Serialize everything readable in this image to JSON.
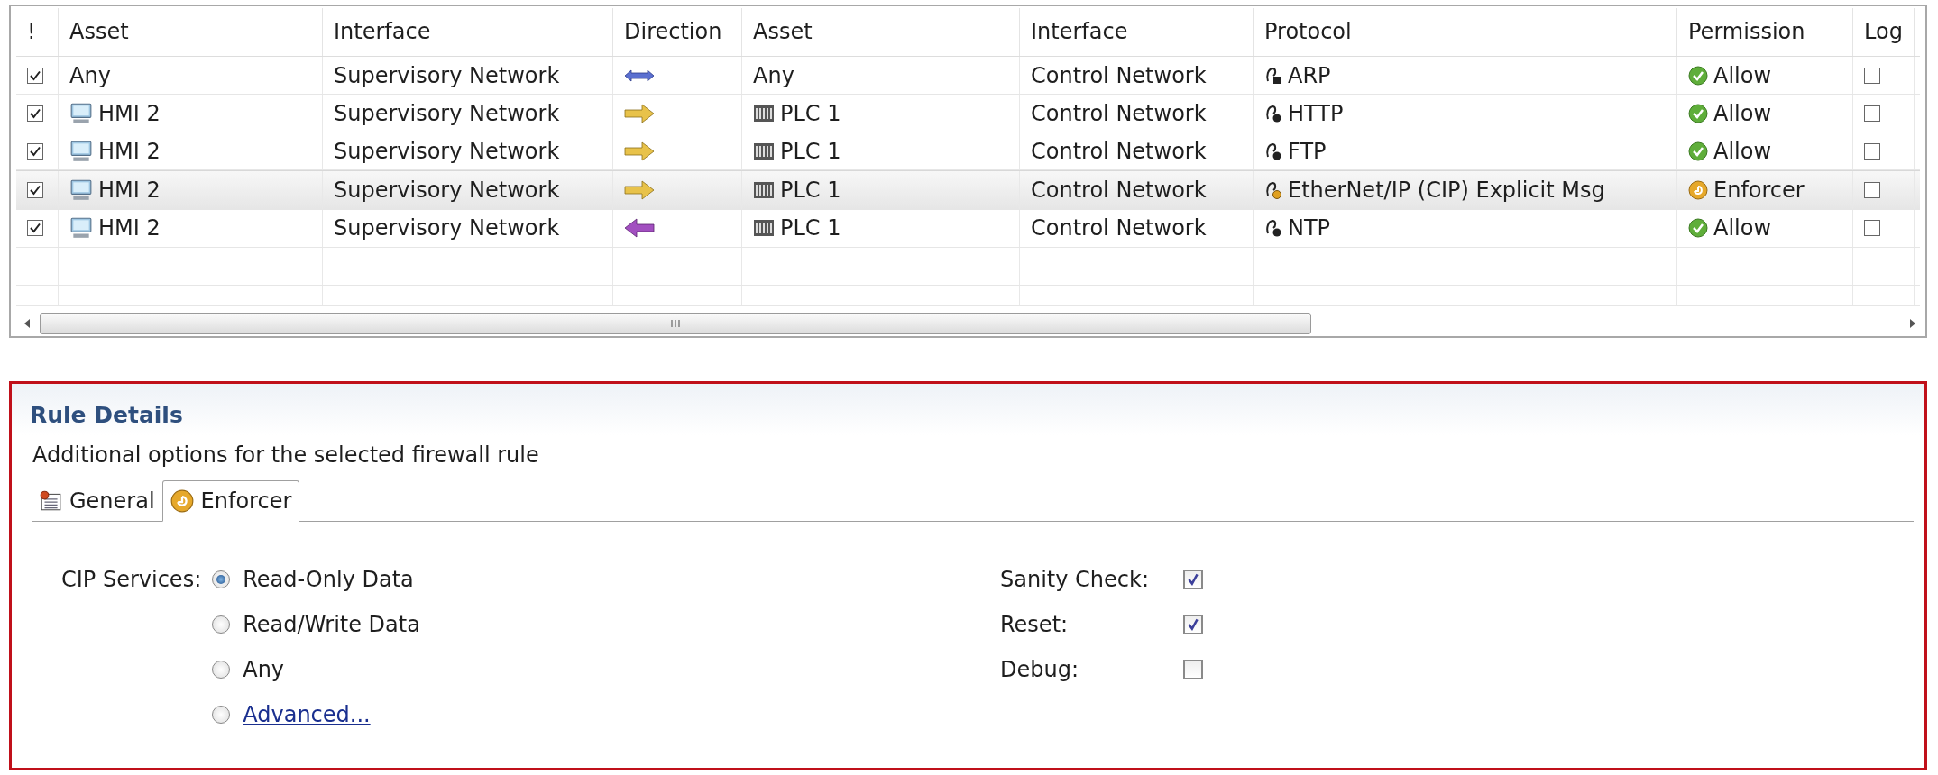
{
  "table": {
    "columns": [
      "!",
      "Asset",
      "Interface",
      "Direction",
      "Asset",
      "Interface",
      "Protocol",
      "Permission",
      "Log"
    ],
    "rows": [
      {
        "enabled": true,
        "source": {
          "text": "Any",
          "kind": "any"
        },
        "source_interface": "Supervisory Network",
        "direction": {
          "kind": "both"
        },
        "target": {
          "text": "Any",
          "kind": "any"
        },
        "target_interface": "Control Network",
        "protocol": {
          "text": "ARP",
          "kind": "eth"
        },
        "permission": {
          "text": "Allow",
          "kind": "allow"
        },
        "log": false,
        "selected": false
      },
      {
        "enabled": true,
        "source": {
          "text": "HMI 2",
          "kind": "hmi"
        },
        "source_interface": "Supervisory Network",
        "direction": {
          "kind": "right"
        },
        "target": {
          "text": "PLC 1",
          "kind": "plc"
        },
        "target_interface": "Control Network",
        "protocol": {
          "text": "HTTP",
          "kind": "ip"
        },
        "permission": {
          "text": "Allow",
          "kind": "allow"
        },
        "log": false,
        "selected": false
      },
      {
        "enabled": true,
        "source": {
          "text": "HMI 2",
          "kind": "hmi"
        },
        "source_interface": "Supervisory Network",
        "direction": {
          "kind": "right"
        },
        "target": {
          "text": "PLC 1",
          "kind": "plc"
        },
        "target_interface": "Control Network",
        "protocol": {
          "text": "FTP",
          "kind": "ip"
        },
        "permission": {
          "text": "Allow",
          "kind": "allow"
        },
        "log": false,
        "selected": false
      },
      {
        "enabled": true,
        "source": {
          "text": "HMI 2",
          "kind": "hmi"
        },
        "source_interface": "Supervisory Network",
        "direction": {
          "kind": "right"
        },
        "target": {
          "text": "PLC 1",
          "kind": "plc"
        },
        "target_interface": "Control Network",
        "protocol": {
          "text": "EtherNet/IP (CIP) Explicit Msg",
          "kind": "cip"
        },
        "permission": {
          "text": "Enforcer",
          "kind": "enforcer"
        },
        "log": false,
        "selected": true
      },
      {
        "enabled": true,
        "source": {
          "text": "HMI 2",
          "kind": "hmi"
        },
        "source_interface": "Supervisory Network",
        "direction": {
          "kind": "left"
        },
        "target": {
          "text": "PLC 1",
          "kind": "plc"
        },
        "target_interface": "Control Network",
        "protocol": {
          "text": "NTP",
          "kind": "ip"
        },
        "permission": {
          "text": "Allow",
          "kind": "allow"
        },
        "log": false,
        "selected": false
      }
    ]
  },
  "rule_details": {
    "title": "Rule Details",
    "description": "Additional options for the selected firewall rule",
    "tabs": [
      {
        "label": "General",
        "kind": "general",
        "selected": false
      },
      {
        "label": "Enforcer",
        "kind": "enforcer",
        "selected": true
      }
    ],
    "cip_services": {
      "label": "CIP Services:",
      "options": [
        {
          "label": "Read-Only Data",
          "kind": "text",
          "selected": true
        },
        {
          "label": "Read/Write Data",
          "kind": "text",
          "selected": false
        },
        {
          "label": "Any",
          "kind": "text",
          "selected": false
        },
        {
          "label": "Advanced...",
          "kind": "link",
          "selected": false
        }
      ]
    },
    "checks": [
      {
        "label": "Sanity Check:",
        "checked": true
      },
      {
        "label": "Reset:",
        "checked": true
      },
      {
        "label": "Debug:",
        "checked": false
      }
    ]
  }
}
